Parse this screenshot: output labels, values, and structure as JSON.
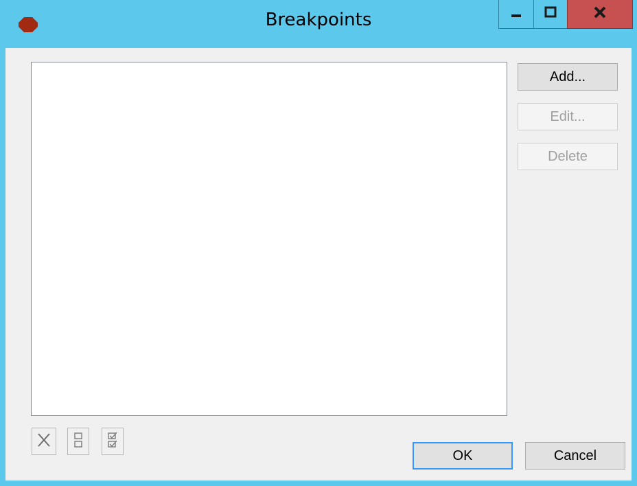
{
  "window": {
    "title": "Breakpoints",
    "title_bar_color": "#5cc8ec",
    "close_button_color": "#c75050",
    "app_icon": "stop-sign-icon",
    "app_icon_color": "#a12a12"
  },
  "title_buttons": {
    "minimize_icon": "minimize-icon",
    "maximize_icon": "maximize-icon",
    "close_icon": "close-icon"
  },
  "breakpoint_list": {
    "items": []
  },
  "side_buttons": {
    "add_label": "Add...",
    "edit_label": "Edit...",
    "delete_label": "Delete"
  },
  "toolbar": {
    "remove_icon": "remove-all-icon",
    "disable_icon": "disable-all-icon",
    "enable_icon": "enable-all-icon"
  },
  "footer": {
    "ok_label": "OK",
    "cancel_label": "Cancel"
  }
}
